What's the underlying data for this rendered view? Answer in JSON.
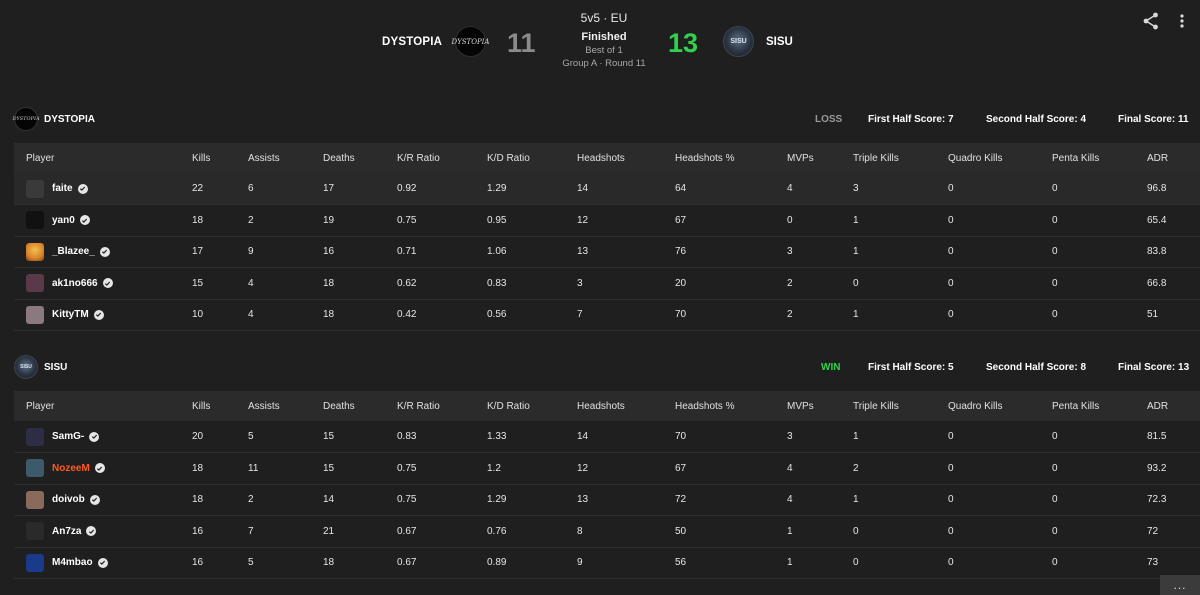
{
  "header": {
    "mode": "5v5 · EU",
    "status": "Finished",
    "best_of": "Best of 1",
    "round": "Group A · Round 11",
    "team_left": {
      "name": "DYSTOPIA",
      "logo_text": "DYSTOPIA",
      "score": "11"
    },
    "team_right": {
      "name": "SISU",
      "logo_text": "SISU",
      "score": "13"
    }
  },
  "columns": [
    "Player",
    "Kills",
    "Assists",
    "Deaths",
    "K/R Ratio",
    "K/D Ratio",
    "Headshots",
    "Headshots %",
    "MVPs",
    "Triple Kills",
    "Quadro Kills",
    "Penta Kills",
    "ADR"
  ],
  "teams": [
    {
      "name": "DYSTOPIA",
      "logo_text": "DYSTOPIA",
      "result": "LOSS",
      "first_half": "First Half Score: 7",
      "second_half": "Second Half Score: 4",
      "final": "Final Score: 11",
      "players": [
        {
          "name": "faite",
          "stats": [
            "22",
            "6",
            "17",
            "0.92",
            "1.29",
            "14",
            "64",
            "4",
            "3",
            "0",
            "0",
            "96.8"
          ]
        },
        {
          "name": "yan0",
          "stats": [
            "18",
            "2",
            "19",
            "0.75",
            "0.95",
            "12",
            "67",
            "0",
            "1",
            "0",
            "0",
            "65.4"
          ]
        },
        {
          "name": "_Blazee_",
          "stats": [
            "17",
            "9",
            "16",
            "0.71",
            "1.06",
            "13",
            "76",
            "3",
            "1",
            "0",
            "0",
            "83.8"
          ]
        },
        {
          "name": "ak1no666",
          "stats": [
            "15",
            "4",
            "18",
            "0.62",
            "0.83",
            "3",
            "20",
            "2",
            "0",
            "0",
            "0",
            "66.8"
          ]
        },
        {
          "name": "KittyTM",
          "stats": [
            "10",
            "4",
            "18",
            "0.42",
            "0.56",
            "7",
            "70",
            "2",
            "1",
            "0",
            "0",
            "51"
          ]
        }
      ]
    },
    {
      "name": "SISU",
      "logo_text": "SISU",
      "result": "WIN",
      "first_half": "First Half Score: 5",
      "second_half": "Second Half Score: 8",
      "final": "Final Score: 13",
      "players": [
        {
          "name": "SamG-",
          "stats": [
            "20",
            "5",
            "15",
            "0.83",
            "1.33",
            "14",
            "70",
            "3",
            "1",
            "0",
            "0",
            "81.5"
          ]
        },
        {
          "name": "NozeeM",
          "stats": [
            "18",
            "11",
            "15",
            "0.75",
            "1.2",
            "12",
            "67",
            "4",
            "2",
            "0",
            "0",
            "93.2"
          ]
        },
        {
          "name": "doivob",
          "stats": [
            "18",
            "2",
            "14",
            "0.75",
            "1.29",
            "13",
            "72",
            "4",
            "1",
            "0",
            "0",
            "72.3"
          ]
        },
        {
          "name": "An7za",
          "stats": [
            "16",
            "7",
            "21",
            "0.67",
            "0.76",
            "8",
            "50",
            "1",
            "0",
            "0",
            "0",
            "72"
          ]
        },
        {
          "name": "M4mbao",
          "stats": [
            "16",
            "5",
            "18",
            "0.67",
            "0.89",
            "9",
            "56",
            "1",
            "0",
            "0",
            "0",
            "73"
          ]
        }
      ]
    }
  ],
  "colors": {
    "win": "#32d14d",
    "loss_score": "#8b8b8b",
    "highlight_player": "#ff5a1f",
    "background": "#1f1f1f"
  },
  "icons": {
    "share": "share-icon",
    "more": "more-vertical-icon",
    "verified": "verified-check-icon",
    "chat": "chat-icon"
  },
  "chat_label": "..."
}
